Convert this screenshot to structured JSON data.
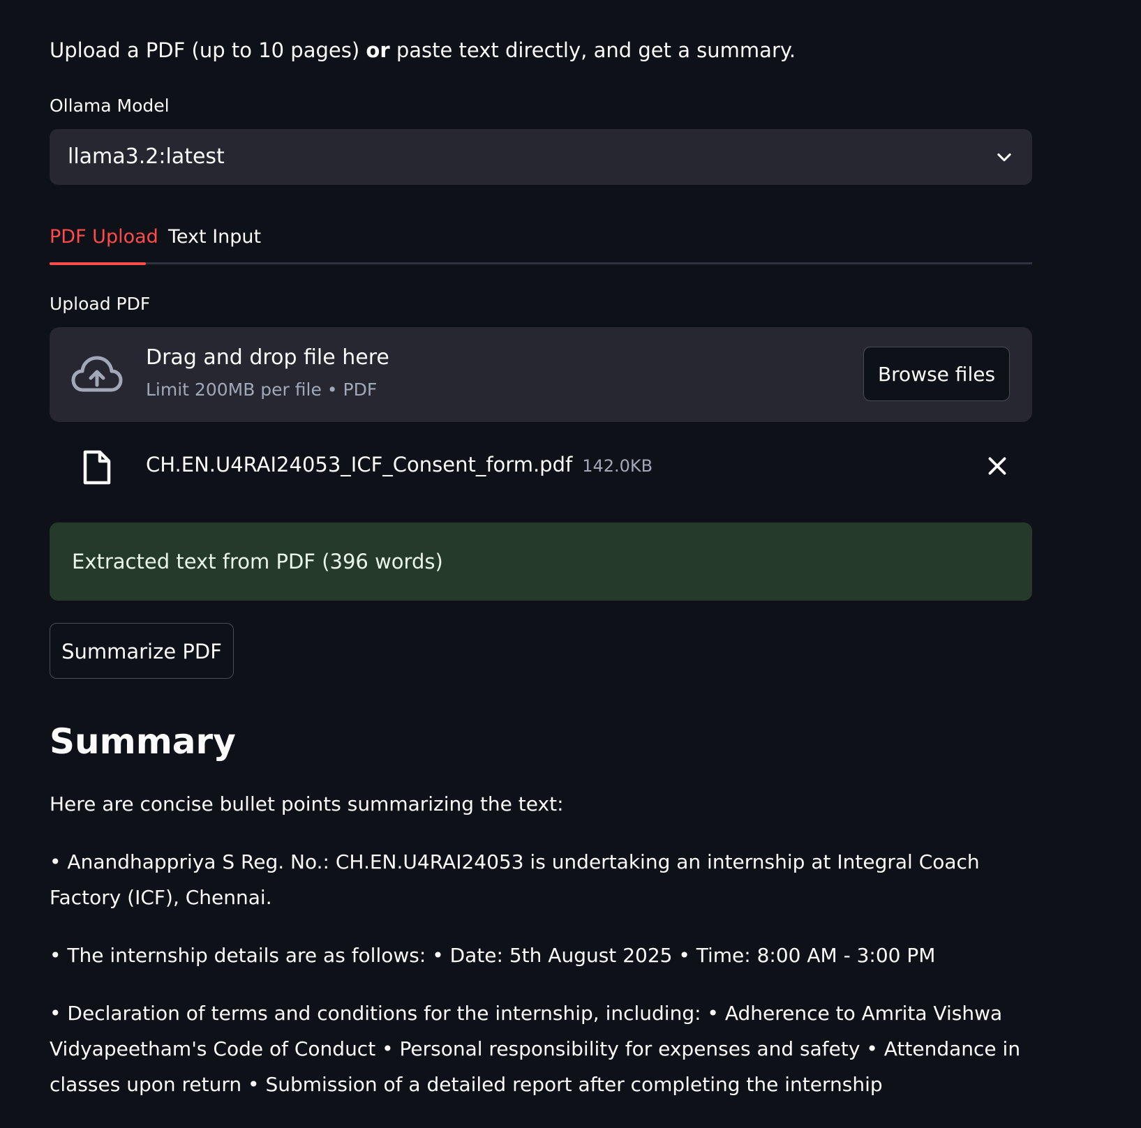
{
  "intro": {
    "prefix": "Upload a PDF (up to 10 pages) ",
    "bold": "or",
    "suffix": " paste text directly, and get a summary."
  },
  "model": {
    "label": "Ollama Model",
    "selected": "llama3.2:latest",
    "icon": "chevron-down-icon"
  },
  "tabs": {
    "items": [
      {
        "label": "PDF Upload",
        "active": true
      },
      {
        "label": "Text Input",
        "active": false
      }
    ],
    "accent_color": "#ff4b4b"
  },
  "upload": {
    "label": "Upload PDF",
    "dropzone_title": "Drag and drop file here",
    "dropzone_subtitle": "Limit 200MB per file • PDF",
    "browse_label": "Browse files",
    "icon": "cloud-upload-icon"
  },
  "file": {
    "name": "CH.EN.U4RAI24053_ICF_Consent_form.pdf",
    "size": "142.0KB",
    "icon": "file-icon",
    "remove_icon": "close-icon"
  },
  "status": {
    "message": "Extracted text from PDF (396 words)",
    "color": "#253a2b"
  },
  "actions": {
    "summarize_label": "Summarize PDF"
  },
  "summary": {
    "title": "Summary",
    "paragraphs": [
      "Here are concise bullet points summarizing the text:",
      "• Anandhappriya S Reg. No.: CH.EN.U4RAI24053 is undertaking an internship at Integral Coach Factory (ICF), Chennai.",
      "• The internship details are as follows: • Date: 5th August 2025 • Time: 8:00 AM - 3:00 PM",
      "• Declaration of terms and conditions for the internship, including: • Adherence to Amrita Vishwa Vidyapeetham's Code of Conduct • Personal responsibility for expenses and safety • Attendance in classes upon return • Submission of a detailed report after completing the internship"
    ]
  },
  "theme": {
    "background": "#0e1117",
    "surface": "#262730",
    "text": "#fafafa",
    "muted": "#a3a8b8"
  }
}
